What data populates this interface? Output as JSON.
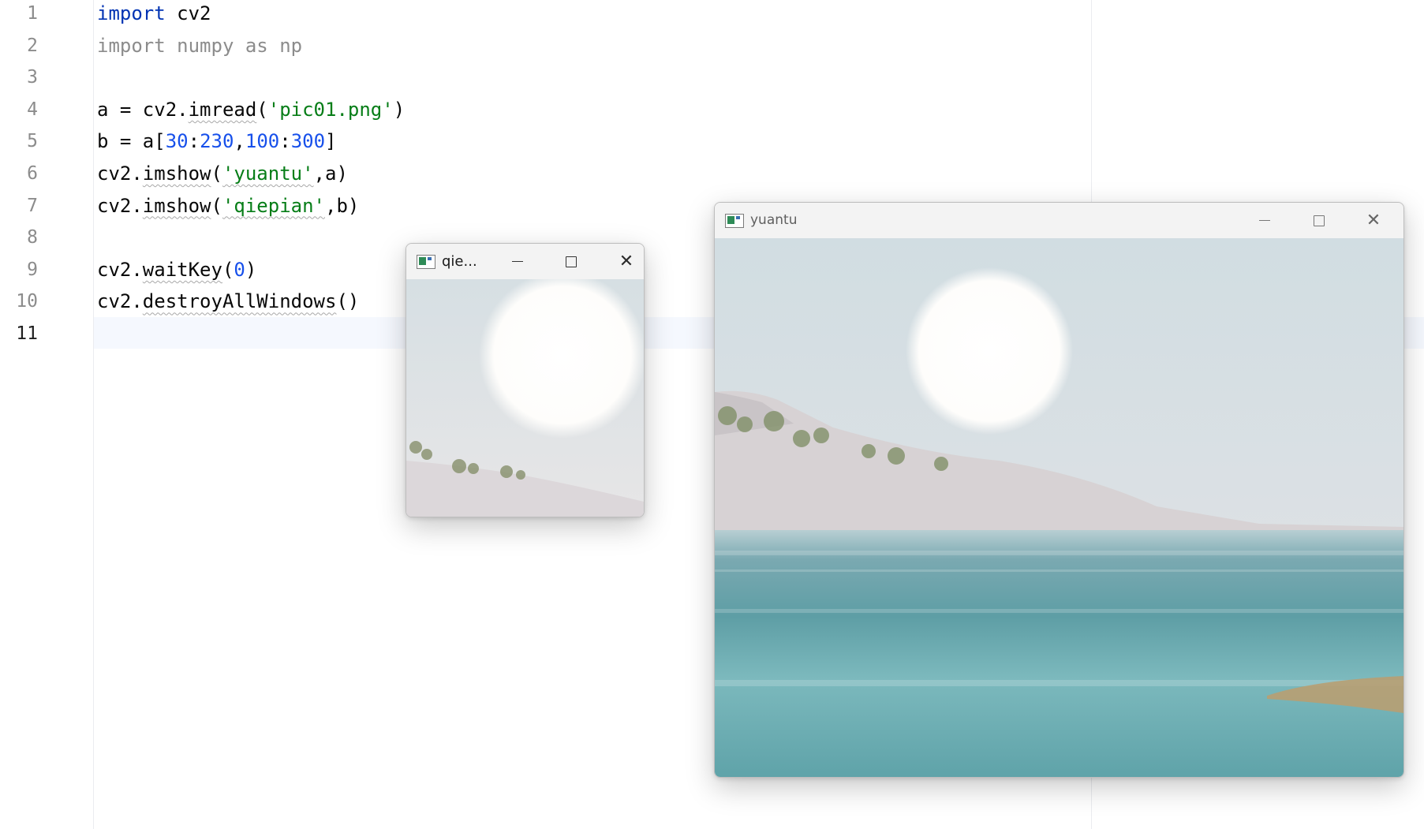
{
  "editor": {
    "lines": [
      {
        "number": "1",
        "tokens": [
          {
            "t": "import",
            "c": "kw"
          },
          {
            "t": " cv2",
            "c": ""
          }
        ]
      },
      {
        "number": "2",
        "tokens": [
          {
            "t": "import numpy as np",
            "c": "unused"
          }
        ]
      },
      {
        "number": "3",
        "tokens": []
      },
      {
        "number": "4",
        "tokens": [
          {
            "t": "a = cv2.",
            "c": ""
          },
          {
            "t": "imread",
            "c": "squig"
          },
          {
            "t": "(",
            "c": ""
          },
          {
            "t": "'pic01.png'",
            "c": "str"
          },
          {
            "t": ")",
            "c": ""
          }
        ]
      },
      {
        "number": "5",
        "tokens": [
          {
            "t": "b = a[",
            "c": ""
          },
          {
            "t": "30",
            "c": "num"
          },
          {
            "t": ":",
            "c": ""
          },
          {
            "t": "230",
            "c": "num"
          },
          {
            "t": ",",
            "c": ""
          },
          {
            "t": "100",
            "c": "num"
          },
          {
            "t": ":",
            "c": ""
          },
          {
            "t": "300",
            "c": "num"
          },
          {
            "t": "]",
            "c": ""
          }
        ]
      },
      {
        "number": "6",
        "tokens": [
          {
            "t": "cv2.",
            "c": ""
          },
          {
            "t": "imshow",
            "c": "squig"
          },
          {
            "t": "(",
            "c": ""
          },
          {
            "t": "'yuantu'",
            "c": "str squig"
          },
          {
            "t": ",a)",
            "c": ""
          }
        ]
      },
      {
        "number": "7",
        "tokens": [
          {
            "t": "cv2.",
            "c": ""
          },
          {
            "t": "imshow",
            "c": "squig"
          },
          {
            "t": "(",
            "c": ""
          },
          {
            "t": "'qiepian'",
            "c": "str squig"
          },
          {
            "t": ",b)",
            "c": ""
          }
        ]
      },
      {
        "number": "8",
        "tokens": []
      },
      {
        "number": "9",
        "tokens": [
          {
            "t": "cv2.",
            "c": ""
          },
          {
            "t": "waitKey",
            "c": "squig"
          },
          {
            "t": "(",
            "c": ""
          },
          {
            "t": "0",
            "c": "num"
          },
          {
            "t": ")",
            "c": ""
          }
        ]
      },
      {
        "number": "10",
        "tokens": [
          {
            "t": "cv2.",
            "c": ""
          },
          {
            "t": "destroyAllWindows",
            "c": "squig"
          },
          {
            "t": "()",
            "c": ""
          }
        ]
      },
      {
        "number": "11",
        "tokens": []
      }
    ],
    "current_line": "11"
  },
  "windows": {
    "qiepian": {
      "title": "qie..."
    },
    "yuantu": {
      "title": "yuantu"
    }
  },
  "icons": {
    "app": "opencv-window-icon",
    "minimize": "minimize-icon",
    "maximize": "maximize-icon",
    "close": "close-icon"
  },
  "colors": {
    "keyword": "#0033b3",
    "string": "#067d17",
    "number": "#1750eb",
    "unused": "#8c8c8c",
    "caret_line": "#f5f8fe"
  }
}
